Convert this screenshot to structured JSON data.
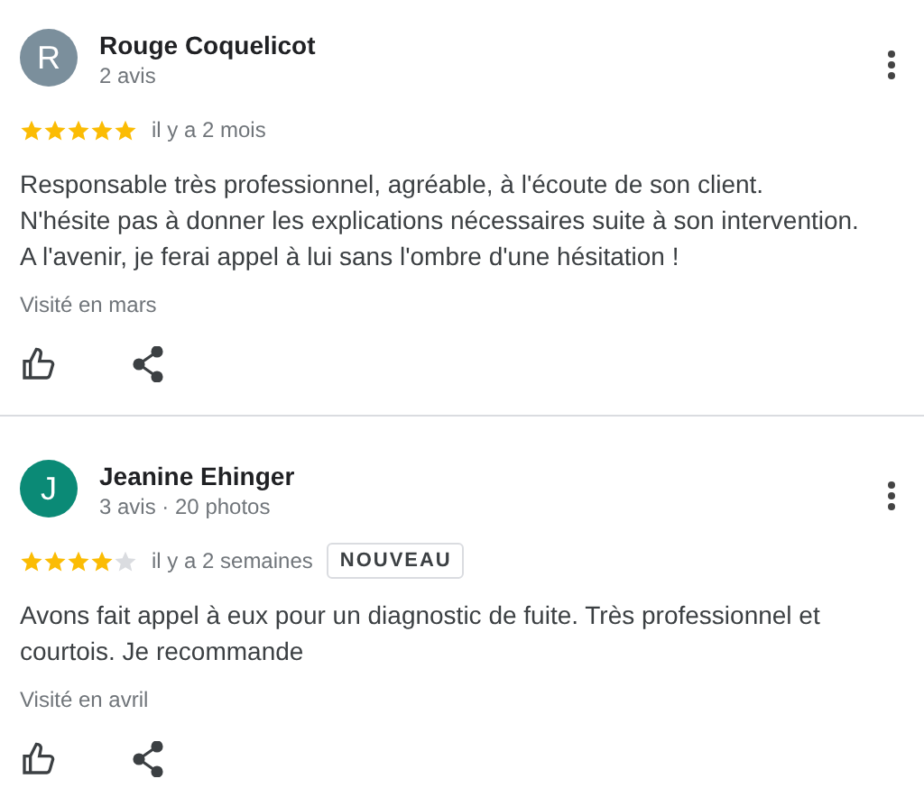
{
  "reviews": [
    {
      "initial": "R",
      "color": "#7b8f9c",
      "name": "Rouge Coquelicot",
      "meta": "2 avis",
      "stars": 5,
      "time": "il y a 2 mois",
      "text": "Responsable très professionnel, agréable, à l'écoute de son client.\nN'hésite pas à donner les explications nécessaires suite à son intervention.\nA l'avenir, je ferai appel à lui sans l'ombre d'une hésitation !",
      "visited": "Visité en mars"
    },
    {
      "initial": "J",
      "color": "#0b8a76",
      "name": "Jeanine Ehinger",
      "meta": "3 avis · 20 photos",
      "stars": 4,
      "time": "il y a 2 semaines",
      "badge": "NOUVEAU",
      "text": "Avons fait appel à eux pour un diagnostic de fuite. Très professionnel et courtois. Je recommande",
      "visited": "Visité en avril"
    }
  ]
}
